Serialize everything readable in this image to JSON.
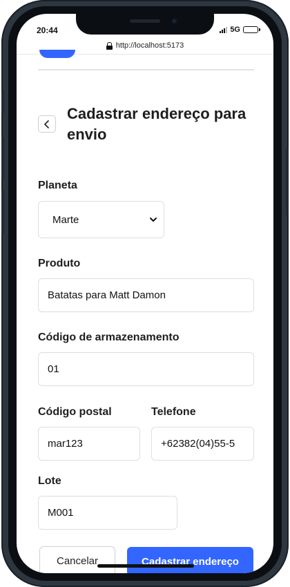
{
  "status_bar": {
    "time": "20:44",
    "network": "5G"
  },
  "browser": {
    "url": "http://localhost:5173"
  },
  "page": {
    "title": "Cadastrar endereço para envio"
  },
  "form": {
    "planet": {
      "label": "Planeta",
      "value": "Marte"
    },
    "product": {
      "label": "Produto",
      "value": "Batatas para Matt Damon"
    },
    "storage_code": {
      "label": "Código de armazenamento",
      "value": "01"
    },
    "postal_code": {
      "label": "Código postal",
      "value": "mar123"
    },
    "phone": {
      "label": "Telefone",
      "value": "+62382(04)55-5"
    },
    "lot": {
      "label": "Lote",
      "value": "M001"
    }
  },
  "actions": {
    "cancel_label": "Cancelar",
    "submit_label": "Cadastrar endereço"
  },
  "colors": {
    "accent": "#3366ff",
    "frame": "#2e3640"
  },
  "icons": {
    "back": "chevron-left-icon",
    "select": "chevron-down-icon",
    "lock": "lock-icon"
  }
}
